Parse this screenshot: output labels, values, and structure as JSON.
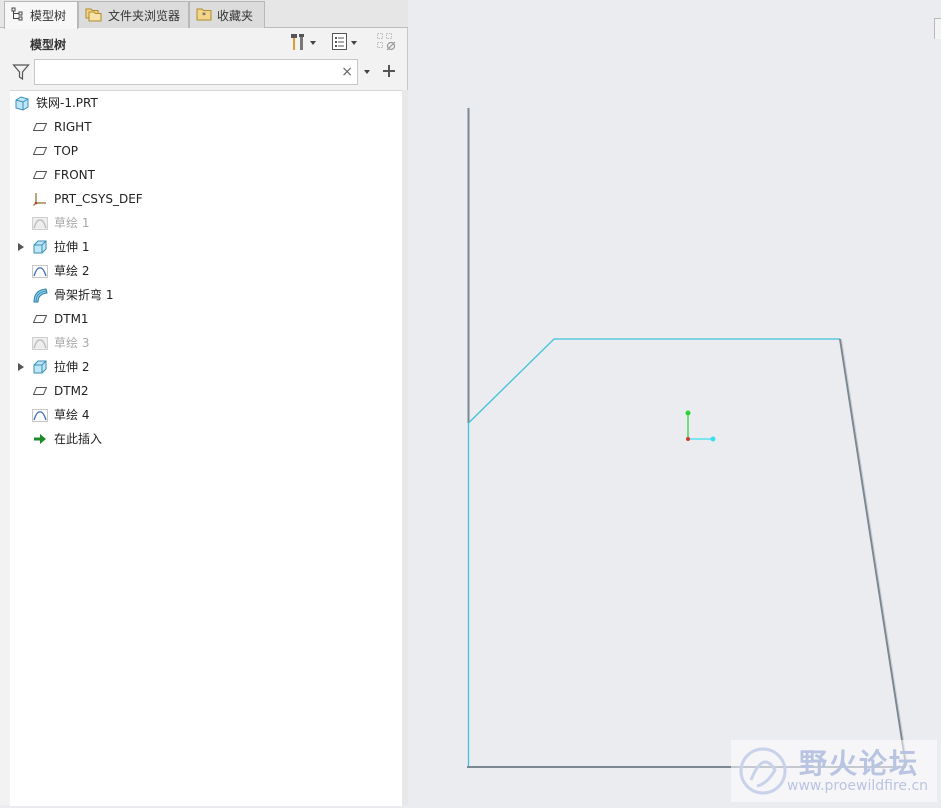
{
  "tabs": [
    {
      "label": "模型树",
      "active": true
    },
    {
      "label": "文件夹浏览器",
      "active": false
    },
    {
      "label": "收藏夹",
      "active": false
    }
  ],
  "tree_header": {
    "title": "模型树"
  },
  "filter": {
    "value": "",
    "placeholder": "",
    "clear_symbol": "×"
  },
  "tree_items": [
    {
      "label": "铁网-1.PRT",
      "icon": "part-icon",
      "expandable": false,
      "dim": false
    },
    {
      "label": "RIGHT",
      "icon": "datum-plane-icon",
      "expandable": false,
      "dim": false
    },
    {
      "label": "TOP",
      "icon": "datum-plane-icon",
      "expandable": false,
      "dim": false
    },
    {
      "label": "FRONT",
      "icon": "datum-plane-icon",
      "expandable": false,
      "dim": false
    },
    {
      "label": "PRT_CSYS_DEF",
      "icon": "coordinate-system-icon",
      "expandable": false,
      "dim": false
    },
    {
      "label": "草绘 1",
      "icon": "sketch-icon",
      "expandable": false,
      "dim": true
    },
    {
      "label": "拉伸 1",
      "icon": "extrude-icon",
      "expandable": true,
      "dim": false
    },
    {
      "label": "草绘 2",
      "icon": "sketch-icon",
      "expandable": false,
      "dim": false
    },
    {
      "label": "骨架折弯 1",
      "icon": "spinal-bend-icon",
      "expandable": false,
      "dim": false
    },
    {
      "label": "DTM1",
      "icon": "datum-plane-icon",
      "expandable": false,
      "dim": false
    },
    {
      "label": "草绘 3",
      "icon": "sketch-icon",
      "expandable": false,
      "dim": true
    },
    {
      "label": "拉伸 2",
      "icon": "extrude-icon",
      "expandable": true,
      "dim": false
    },
    {
      "label": "DTM2",
      "icon": "datum-plane-icon",
      "expandable": false,
      "dim": false
    },
    {
      "label": "草绘 4",
      "icon": "sketch-icon",
      "expandable": false,
      "dim": false
    },
    {
      "label": "在此插入",
      "icon": "insert-here-arrow-icon",
      "expandable": false,
      "dim": false
    }
  ],
  "watermark": {
    "title": "野火论坛",
    "url": "www.proewildfire.cn"
  },
  "colors": {
    "sketch_edge": "#3fc3dc",
    "part_edge": "#7b8792",
    "csys_y": "#2ad33a",
    "csys_x": "#39e0ee",
    "csys_origin": "#d23b2a",
    "viewport_bg": "#eaecef",
    "watermark_text": "#b9c4e2"
  }
}
